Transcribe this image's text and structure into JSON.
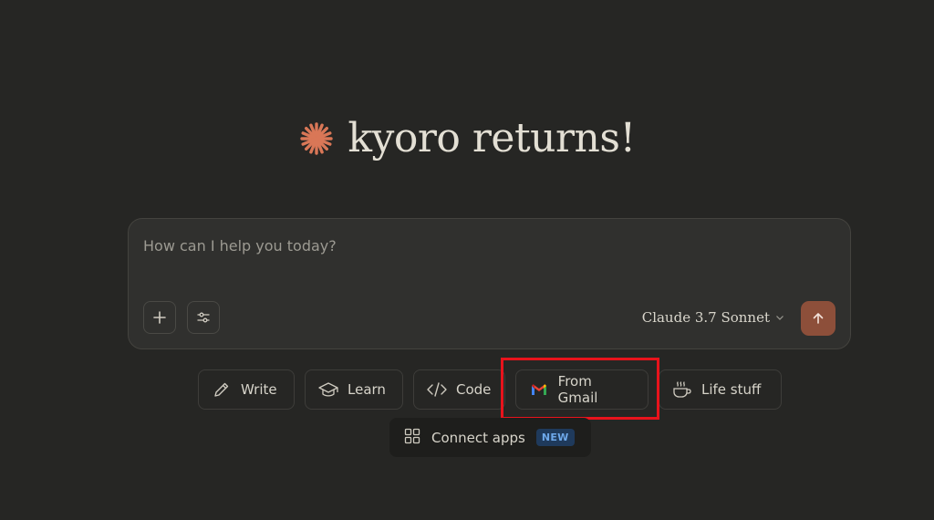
{
  "greeting": {
    "title": "kyoro returns!",
    "logo_icon": "claude-asterisk-icon",
    "logo_color": "#d97757"
  },
  "composer": {
    "placeholder": "How can I help you today?",
    "model": "Claude 3.7 Sonnet",
    "add_icon": "plus-icon",
    "tools_icon": "sliders-icon",
    "send_icon": "arrow-up-icon",
    "send_color": "#8d4f3a"
  },
  "quick_actions": [
    {
      "label": "Write",
      "icon": "pencil-icon"
    },
    {
      "label": "Learn",
      "icon": "graduation-cap-icon"
    },
    {
      "label": "Code",
      "icon": "code-icon"
    },
    {
      "label": "From Gmail",
      "icon": "gmail-icon"
    },
    {
      "label": "Life stuff",
      "icon": "coffee-cup-icon"
    }
  ],
  "connect_apps": {
    "label": "Connect apps",
    "badge": "NEW",
    "icon": "grid-icon"
  },
  "highlight": {
    "target": "From Gmail",
    "color": "#e8131c"
  }
}
